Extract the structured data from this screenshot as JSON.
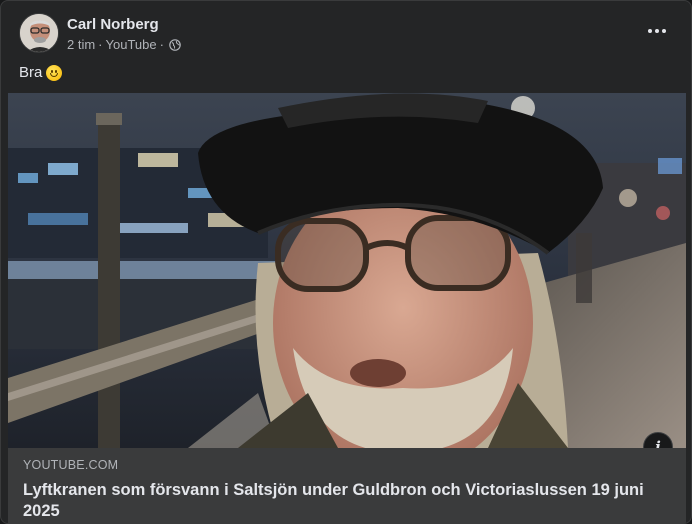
{
  "post": {
    "author": "Carl Norberg",
    "time": "2 tim",
    "separator": "·",
    "source": "YouTube",
    "audience_icon": "globe-icon",
    "text": "Bra",
    "emoji": "slightly-smiling-face-icon"
  },
  "link_preview": {
    "domain": "YOUTUBE.COM",
    "title": "Lyftkranen som försvann i Saltsjön under Guldbron och Victoriaslussen 19 juni 2025",
    "info_glyph": "i"
  },
  "colors": {
    "card_bg": "#242526",
    "link_box_bg": "#3a3b3c",
    "text_primary": "#e4e6eb",
    "text_secondary": "#b0b3b8"
  }
}
